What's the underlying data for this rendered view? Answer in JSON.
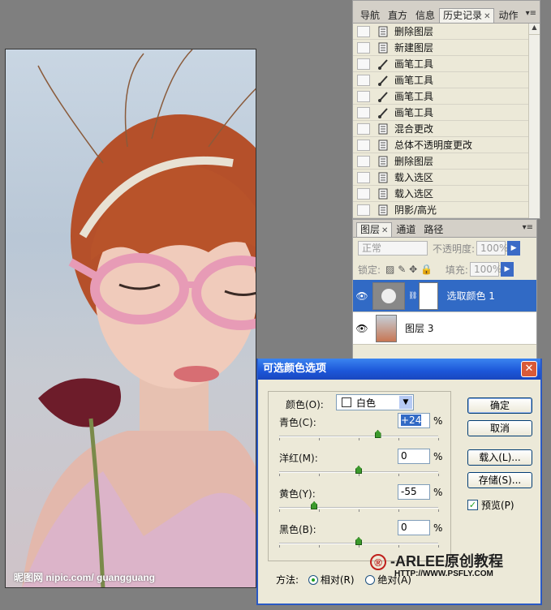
{
  "photo": {
    "watermark": "昵图网 nipic.com/ guangguang"
  },
  "history_panel": {
    "tabs": [
      "导航",
      "直方",
      "信息",
      "历史记录",
      "动作"
    ],
    "items": [
      {
        "label": "删除图层",
        "icon": "history-state-icon"
      },
      {
        "label": "新建图层",
        "icon": "history-state-icon"
      },
      {
        "label": "画笔工具",
        "icon": "brush-icon"
      },
      {
        "label": "画笔工具",
        "icon": "brush-icon"
      },
      {
        "label": "画笔工具",
        "icon": "brush-icon"
      },
      {
        "label": "画笔工具",
        "icon": "brush-icon"
      },
      {
        "label": "混合更改",
        "icon": "history-state-icon"
      },
      {
        "label": "总体不透明度更改",
        "icon": "history-state-icon"
      },
      {
        "label": "删除图层",
        "icon": "history-state-icon"
      },
      {
        "label": "载入选区",
        "icon": "history-state-icon"
      },
      {
        "label": "载入选区",
        "icon": "history-state-icon"
      },
      {
        "label": "阴影/高光",
        "icon": "history-state-icon"
      }
    ]
  },
  "layers_panel": {
    "tabs": [
      "图层",
      "通道",
      "路径"
    ],
    "blend_mode": "正常",
    "opacity_label": "不透明度:",
    "opacity_value": "100%",
    "lock_label": "锁定:",
    "fill_label": "填充:",
    "fill_value": "100%",
    "layers": [
      {
        "name": "选取颜色 1",
        "selected": true
      },
      {
        "name": "图层 3",
        "selected": false
      }
    ]
  },
  "dialog": {
    "title": "可选颜色选项",
    "color_label": "颜色(O):",
    "color_value": "白色",
    "fields": [
      {
        "label": "青色(C):",
        "value": "+24",
        "slider": 0.62
      },
      {
        "label": "洋红(M):",
        "value": "0",
        "slider": 0.5
      },
      {
        "label": "黄色(Y):",
        "value": "-55",
        "slider": 0.22
      },
      {
        "label": "黑色(B):",
        "value": "0",
        "slider": 0.5
      }
    ],
    "percent": "%",
    "buttons": {
      "ok": "确定",
      "cancel": "取消",
      "load": "载入(L)...",
      "save": "存储(S)..."
    },
    "preview_label": "预览(P)",
    "preview_checked": true,
    "method_label": "方法:",
    "method_relative": "相对(R)",
    "method_absolute": "绝对(A)",
    "method_selected": "relative"
  },
  "branding": {
    "mark": "®",
    "text": "-ARLEE原创教程",
    "url": "HTTP://WWW.PSFLY.COM"
  }
}
